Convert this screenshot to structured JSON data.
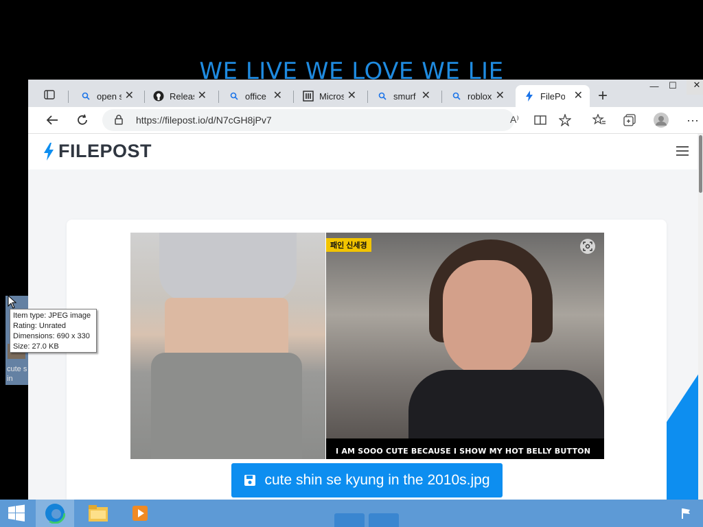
{
  "desktop": {
    "banner_text": "WE LIVE WE LOVE WE LIE",
    "icon_label": "cute s\nin",
    "tooltip": {
      "item_type": "Item type: JPEG image",
      "rating": "Rating: Unrated",
      "dimensions": "Dimensions: 690 x 330",
      "size": "Size: 27.0 KB"
    }
  },
  "browser": {
    "tabs": [
      {
        "label": "open s",
        "icon": "search-icon"
      },
      {
        "label": "Releas",
        "icon": "github-icon"
      },
      {
        "label": "office",
        "icon": "search-icon"
      },
      {
        "label": "Micros",
        "icon": "bank-icon"
      },
      {
        "label": "smurf",
        "icon": "search-icon"
      },
      {
        "label": "roblox",
        "icon": "search-icon"
      },
      {
        "label": "FilePo",
        "icon": "bolt-icon",
        "active": true
      }
    ],
    "url": "https://filepost.io/d/N7cGH8jPv7"
  },
  "site": {
    "logo": "FILEPOST",
    "caption": "I AM SOOO CUTE BECAUSE I SHOW MY HOT BELLY BUTTON",
    "badge": "패인 신세경",
    "download_label": "cute shin se kyung in the 2010s.jpg"
  },
  "colors": {
    "accent": "#0d8ef0",
    "taskbar": "#5d9ad6",
    "banner": "#1f8be0"
  }
}
